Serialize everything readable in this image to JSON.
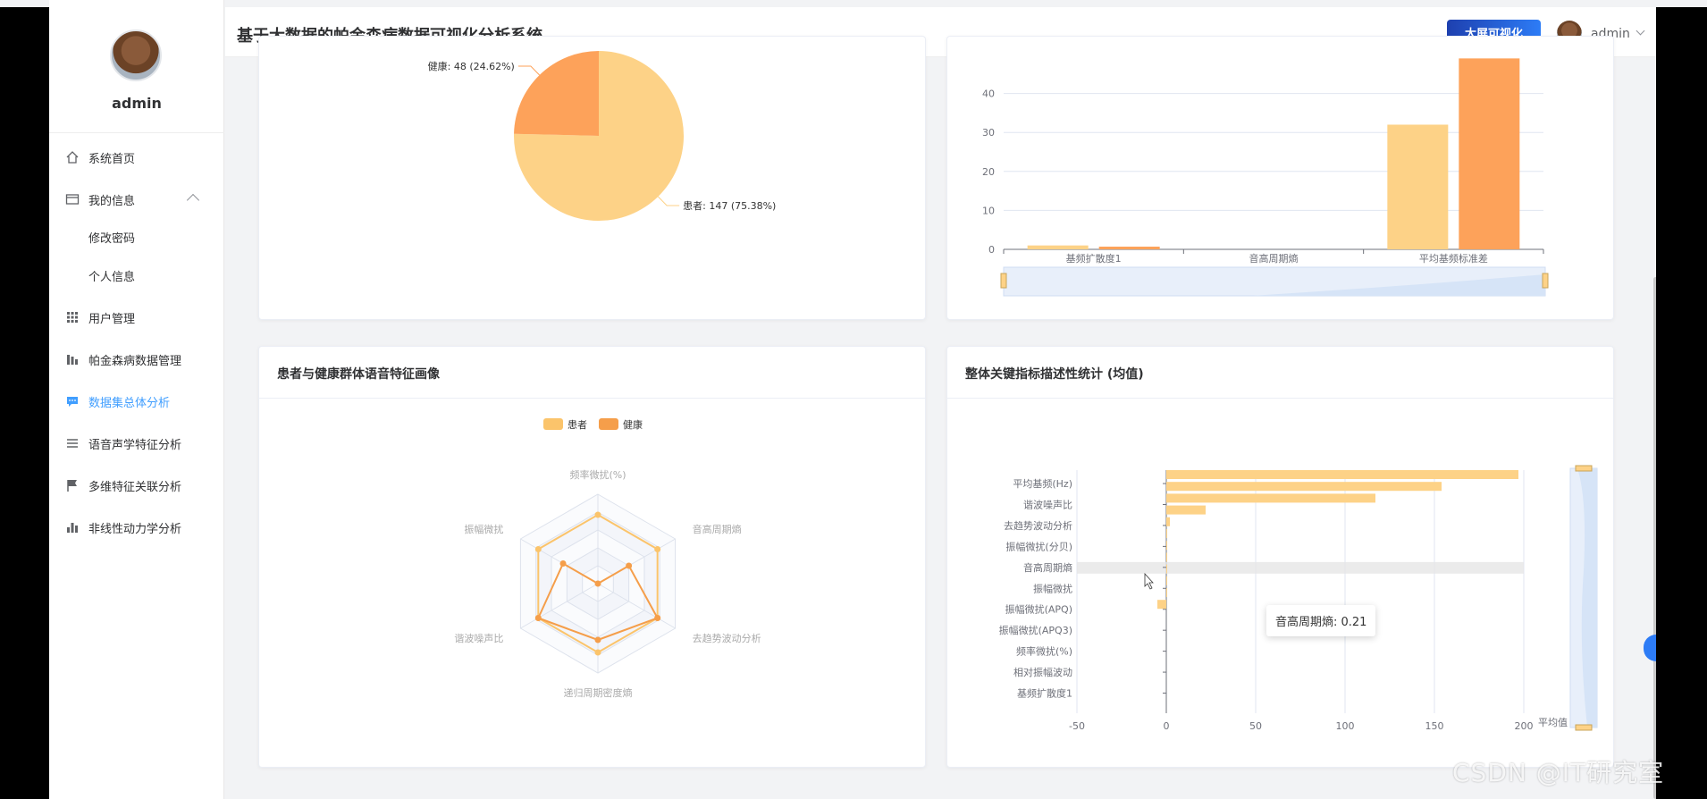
{
  "app": {
    "title": "基于大数据的帕金森病数据可视化分析系统",
    "big_screen_button": "大屏可视化",
    "user": "admin"
  },
  "sidebar": {
    "username": "admin",
    "items": [
      {
        "label": "系统首页",
        "icon": "home-icon"
      },
      {
        "label": "我的信息",
        "icon": "profile-card-icon"
      },
      {
        "label": "修改密码"
      },
      {
        "label": "个人信息"
      },
      {
        "label": "用户管理",
        "icon": "grid-icon"
      },
      {
        "label": "帕金森病数据管理",
        "icon": "bars-icon"
      },
      {
        "label": "数据集总体分析",
        "icon": "chat-icon"
      },
      {
        "label": "语音声学特征分析",
        "icon": "list-icon"
      },
      {
        "label": "多维特征关联分析",
        "icon": "flag-icon"
      },
      {
        "label": "非线性动力学分析",
        "icon": "bar-chart-icon"
      }
    ],
    "active_color": "#409eff"
  },
  "cards": {
    "radar_title": "患者与健康群体语音特征画像",
    "desc_title": "整体关键指标描述性统计 (均值)"
  },
  "chart_data": [
    {
      "type": "pie",
      "labels": [
        "患者",
        "健康"
      ],
      "values": [
        147,
        48
      ],
      "slice_labels": [
        "患者: 147 (75.38%)",
        "健康: 48 (24.62%)"
      ],
      "colors": [
        "#fdd287",
        "#fda25a"
      ]
    },
    {
      "type": "bar",
      "categories": [
        "基频扩散度1",
        "音高周期熵",
        "平均基频标准差"
      ],
      "series": [
        {
          "values": [
            1,
            0,
            32
          ],
          "color": "#fdd287"
        },
        {
          "values": [
            0.7,
            0,
            49
          ],
          "color": "#fda25a"
        }
      ],
      "yticks": [
        "0",
        "10",
        "20",
        "30",
        "40"
      ],
      "ylim": [
        0,
        50
      ]
    },
    {
      "type": "radar",
      "indicators": [
        "频率微扰(%)",
        "音高周期熵",
        "去趋势波动分析",
        "递归周期密度熵",
        "谐波噪声比",
        "振幅微扰"
      ],
      "series": [
        {
          "name": "患者",
          "values": [
            0.77,
            0.77,
            0.77,
            0.77,
            0.77,
            0.77
          ],
          "color": "#fbc46b"
        },
        {
          "name": "健康",
          "values": [
            0.0,
            0.4,
            0.77,
            0.63,
            0.77,
            0.45
          ],
          "color": "#f59e4a"
        }
      ],
      "legend": [
        "患者",
        "健康"
      ]
    },
    {
      "type": "bar",
      "orientation": "horizontal",
      "categories": [
        "平均基频(Hz)",
        "谐波噪声比",
        "去趋势波动分析",
        "振幅微扰(分贝)",
        "音高周期熵",
        "振幅微扰",
        "振幅微扰(APQ)",
        "振幅微扰(APQ3)",
        "频率微扰(%)",
        "相对振幅波动",
        "基频扩散度1"
      ],
      "visible_bar_values": [
        197,
        154,
        117,
        22,
        2,
        0.21,
        0,
        0,
        0,
        0,
        0,
        -5
      ],
      "xticks": [
        "-50",
        "0",
        "50",
        "100",
        "150",
        "200"
      ],
      "xlim": [
        -50,
        200
      ],
      "series_name": "平均值",
      "tooltip": "音高周期熵: 0.21",
      "color": "#fdd287"
    }
  ],
  "watermark": "CSDN @IT研究室"
}
